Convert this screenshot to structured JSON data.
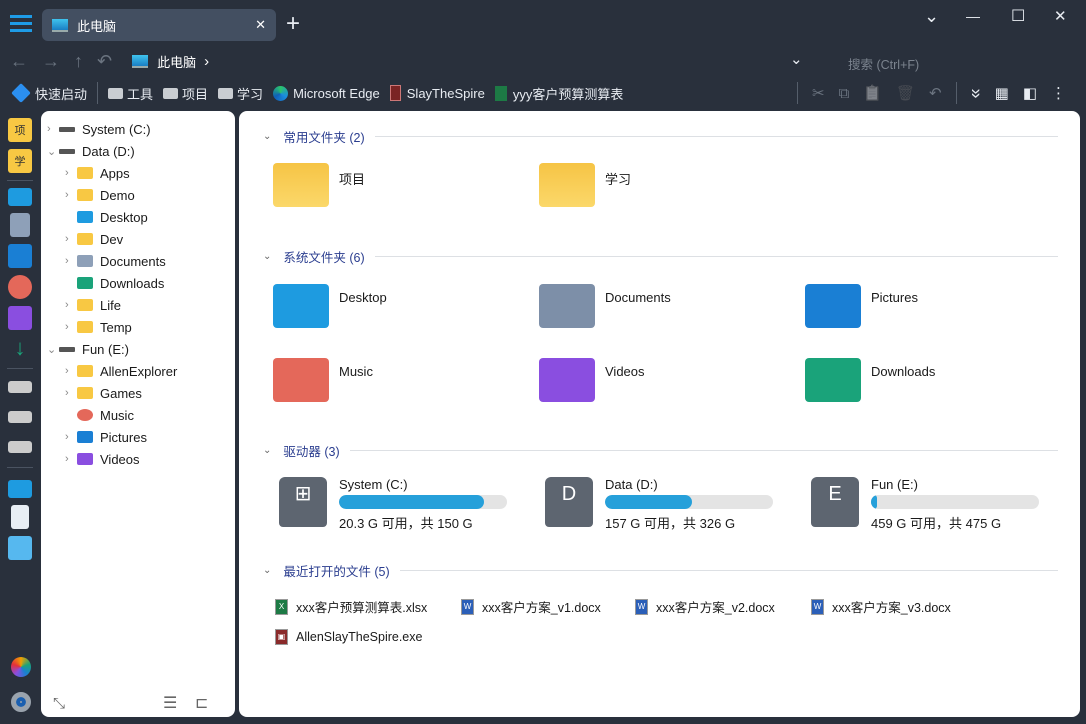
{
  "tab": {
    "title": "此电脑",
    "close": "✕",
    "new": "+"
  },
  "window": {
    "minimize": "—",
    "maximize": "☐",
    "close": "✕",
    "dropdown": "⌄"
  },
  "nav": {
    "back": "←",
    "forward": "→",
    "up": "↑",
    "undo": "↶",
    "breadcrumb": "此电脑",
    "crumb_sep": "›",
    "search_placeholder": "搜索 (Ctrl+F)"
  },
  "quick": [
    {
      "label": "快速启动",
      "icon": "launch-icon"
    },
    {
      "label": "工具",
      "icon": "folder-icon"
    },
    {
      "label": "项目",
      "icon": "folder-icon"
    },
    {
      "label": "学习",
      "icon": "folder-icon"
    },
    {
      "label": "Microsoft Edge",
      "icon": "edge-icon"
    },
    {
      "label": "SlayTheSpire",
      "icon": "game-icon"
    },
    {
      "label": "yyy客户预算测算表",
      "icon": "excel-icon"
    }
  ],
  "toolbar": {
    "cut": "✂",
    "copy": "⧉",
    "paste": "📋",
    "delete": "🗑",
    "undo": "↶",
    "expand": "»",
    "view": "▦",
    "pane": "◧",
    "more": "⋮"
  },
  "rail": {
    "proj": "项",
    "study": "学"
  },
  "tree": [
    {
      "label": "System (C:)",
      "level": 0,
      "exp": "›",
      "icon": "drive"
    },
    {
      "label": "Data (D:)",
      "level": 0,
      "exp": "⌄",
      "icon": "drive"
    },
    {
      "label": "Apps",
      "level": 1,
      "exp": "›",
      "icon": "folder"
    },
    {
      "label": "Demo",
      "level": 1,
      "exp": "›",
      "icon": "folder"
    },
    {
      "label": "Desktop",
      "level": 1,
      "exp": "",
      "icon": "desktop"
    },
    {
      "label": "Dev",
      "level": 1,
      "exp": "›",
      "icon": "folder"
    },
    {
      "label": "Documents",
      "level": 1,
      "exp": "›",
      "icon": "doc"
    },
    {
      "label": "Downloads",
      "level": 1,
      "exp": "",
      "icon": "download"
    },
    {
      "label": "Life",
      "level": 1,
      "exp": "›",
      "icon": "folder"
    },
    {
      "label": "Temp",
      "level": 1,
      "exp": "›",
      "icon": "folder"
    },
    {
      "label": "Fun (E:)",
      "level": 0,
      "exp": "⌄",
      "icon": "drive"
    },
    {
      "label": "AllenExplorer",
      "level": 1,
      "exp": "›",
      "icon": "folder"
    },
    {
      "label": "Games",
      "level": 1,
      "exp": "›",
      "icon": "folder"
    },
    {
      "label": "Music",
      "level": 1,
      "exp": "",
      "icon": "music"
    },
    {
      "label": "Pictures",
      "level": 1,
      "exp": "›",
      "icon": "pictures"
    },
    {
      "label": "Videos",
      "level": 1,
      "exp": "›",
      "icon": "videos"
    }
  ],
  "sections": {
    "common": "常用文件夹 (2)",
    "system": "系统文件夹 (6)",
    "drives": "驱动器 (3)",
    "recent": "最近打开的文件 (5)",
    "chevron": "⌄"
  },
  "common": [
    "项目",
    "学习"
  ],
  "system_folders": [
    {
      "label": "Desktop",
      "color": "#1e9be0"
    },
    {
      "label": "Documents",
      "color": "#7d8fa8"
    },
    {
      "label": "Pictures",
      "color": "#1a7fd4"
    },
    {
      "label": "Music",
      "color": "#e4685a"
    },
    {
      "label": "Videos",
      "color": "#8a4ee0"
    },
    {
      "label": "Downloads",
      "color": "#1aa37a"
    }
  ],
  "drives": [
    {
      "name": "System (C:)",
      "letter": "",
      "info": "20.3 G 可用，共 150 G",
      "used": 0.865
    },
    {
      "name": "Data (D:)",
      "letter": "D",
      "info": "157 G 可用，共 326 G",
      "used": 0.518
    },
    {
      "name": "Fun (E:)",
      "letter": "E",
      "info": "459 G 可用，共 475 G",
      "used": 0.034
    }
  ],
  "recent": [
    {
      "name": "xxx客户预算测算表.xlsx",
      "type": "X",
      "color": "#1d7a45"
    },
    {
      "name": "xxx客户方案_v1.docx",
      "type": "W",
      "color": "#2b5fb8"
    },
    {
      "name": "xxx客户方案_v2.docx",
      "type": "W",
      "color": "#2b5fb8"
    },
    {
      "name": "xxx客户方案_v3.docx",
      "type": "W",
      "color": "#2b5fb8"
    },
    {
      "name": "AllenSlayTheSpire.exe",
      "type": "▣",
      "color": "#8a2a2a"
    }
  ]
}
